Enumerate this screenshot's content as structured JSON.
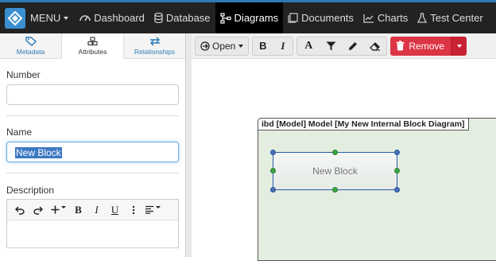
{
  "topbar": {
    "menu_label": "MENU",
    "nav": [
      {
        "label": "Dashboard",
        "icon": "dashboard-icon"
      },
      {
        "label": "Database",
        "icon": "database-icon"
      },
      {
        "label": "Diagrams",
        "icon": "diagrams-icon",
        "active": true
      },
      {
        "label": "Documents",
        "icon": "documents-icon"
      },
      {
        "label": "Charts",
        "icon": "charts-icon"
      },
      {
        "label": "Test Center",
        "icon": "flask-icon"
      }
    ]
  },
  "left_panel": {
    "tabs": [
      {
        "label": "Metadata",
        "icon": "tag-icon"
      },
      {
        "label": "Attributes",
        "icon": "cubes-icon",
        "active": true
      },
      {
        "label": "Relationships",
        "icon": "exchange-icon"
      }
    ],
    "fields": {
      "number_label": "Number",
      "number_value": "",
      "name_label": "Name",
      "name_value": "New Block",
      "description_label": "Description"
    },
    "editor_toolbar": [
      "undo",
      "redo",
      "insert",
      "bold",
      "italic",
      "underline",
      "more",
      "align"
    ]
  },
  "toolbar": {
    "open_label": "Open",
    "remove_label": "Remove"
  },
  "diagram": {
    "frame_title": "ibd [Model] Model [My New Internal Block Diagram]",
    "block_label": "New Block"
  },
  "colors": {
    "accent": "#2a7ab8",
    "danger": "#dc3545",
    "frame_fill": "#e4eee0",
    "selection": "#3b78c2"
  }
}
